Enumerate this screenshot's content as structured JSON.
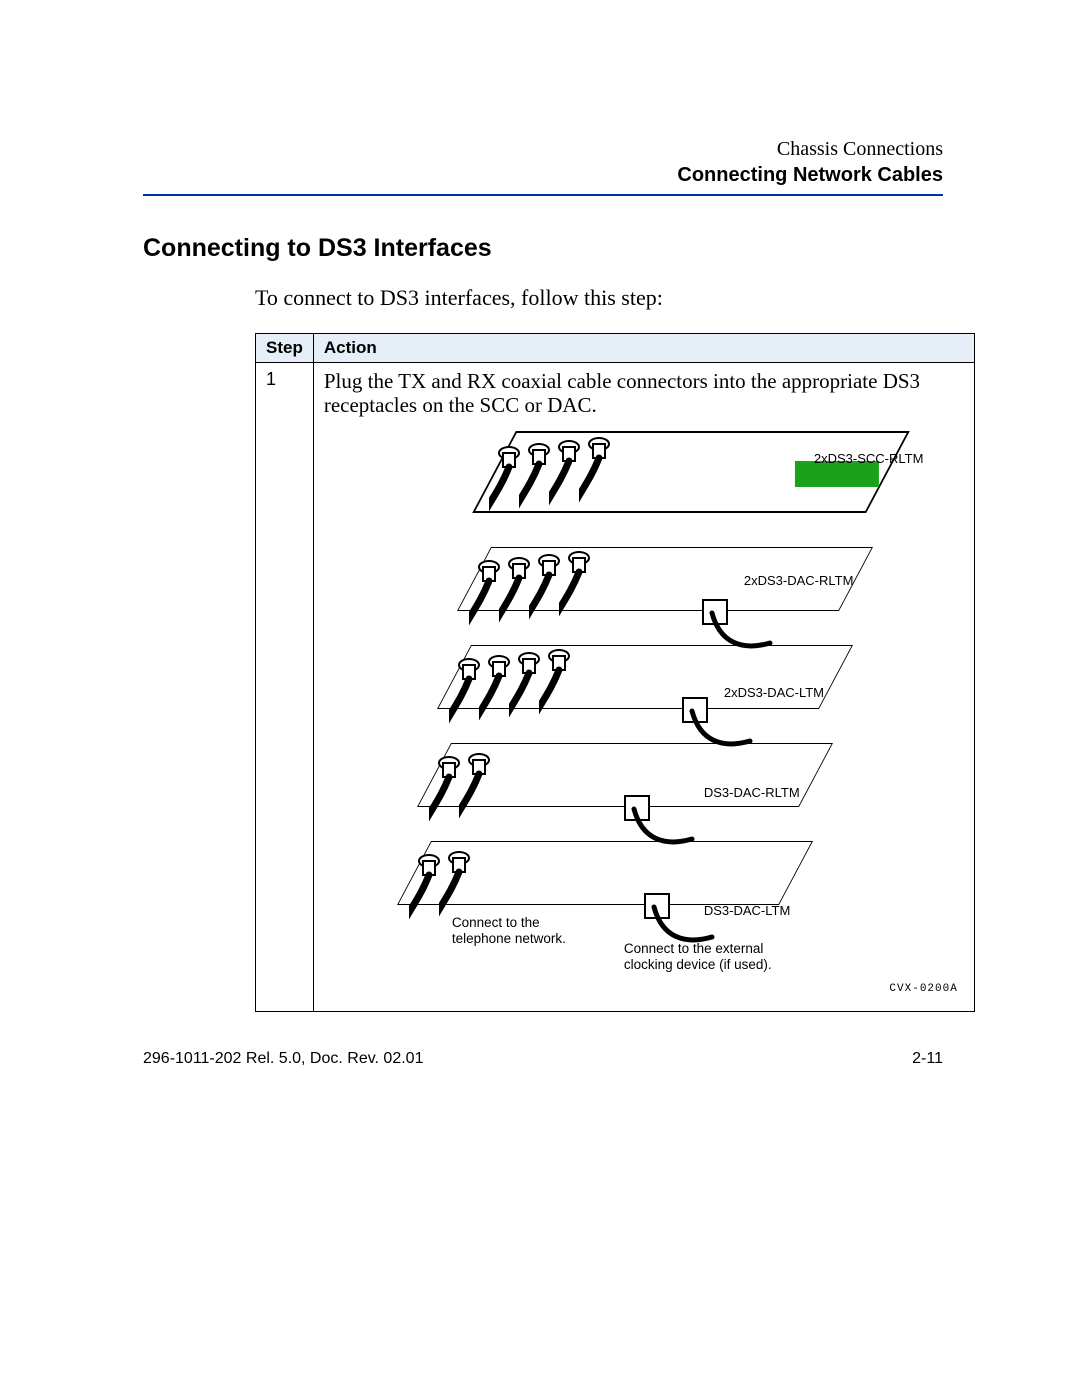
{
  "header": {
    "chapter": "Chassis Connections",
    "section": "Connecting Network Cables"
  },
  "title": "Connecting to DS3 Interfaces",
  "intro": "To connect to DS3 interfaces, follow this step:",
  "table": {
    "columns": {
      "step": "Step",
      "action": "Action"
    },
    "rows": [
      {
        "step": "1",
        "action": "Plug the TX and RX coaxial cable connectors into the appropriate DS3 receptacles on the SCC or DAC."
      }
    ]
  },
  "diagram": {
    "panels": [
      {
        "label": "2xDS3-SCC-RLTM",
        "coax_ports": 4,
        "has_green_block": true
      },
      {
        "label": "2xDS3-DAC-RLTM",
        "coax_ports": 4,
        "has_green_block": false
      },
      {
        "label": "2xDS3-DAC-LTM",
        "coax_ports": 4,
        "has_green_block": false
      },
      {
        "label": "DS3-DAC-RLTM",
        "coax_ports": 2,
        "has_green_block": false
      },
      {
        "label": "DS3-DAC-LTM",
        "coax_ports": 2,
        "has_green_block": false
      }
    ],
    "callouts": [
      "Connect to the telephone network.",
      "Connect to the external clocking device (if used)."
    ],
    "drawing_code": "CVX-0200A"
  },
  "footer": {
    "docinfo": "296-1011-202 Rel. 5.0, Doc. Rev. 02.01",
    "page": "2-11"
  }
}
